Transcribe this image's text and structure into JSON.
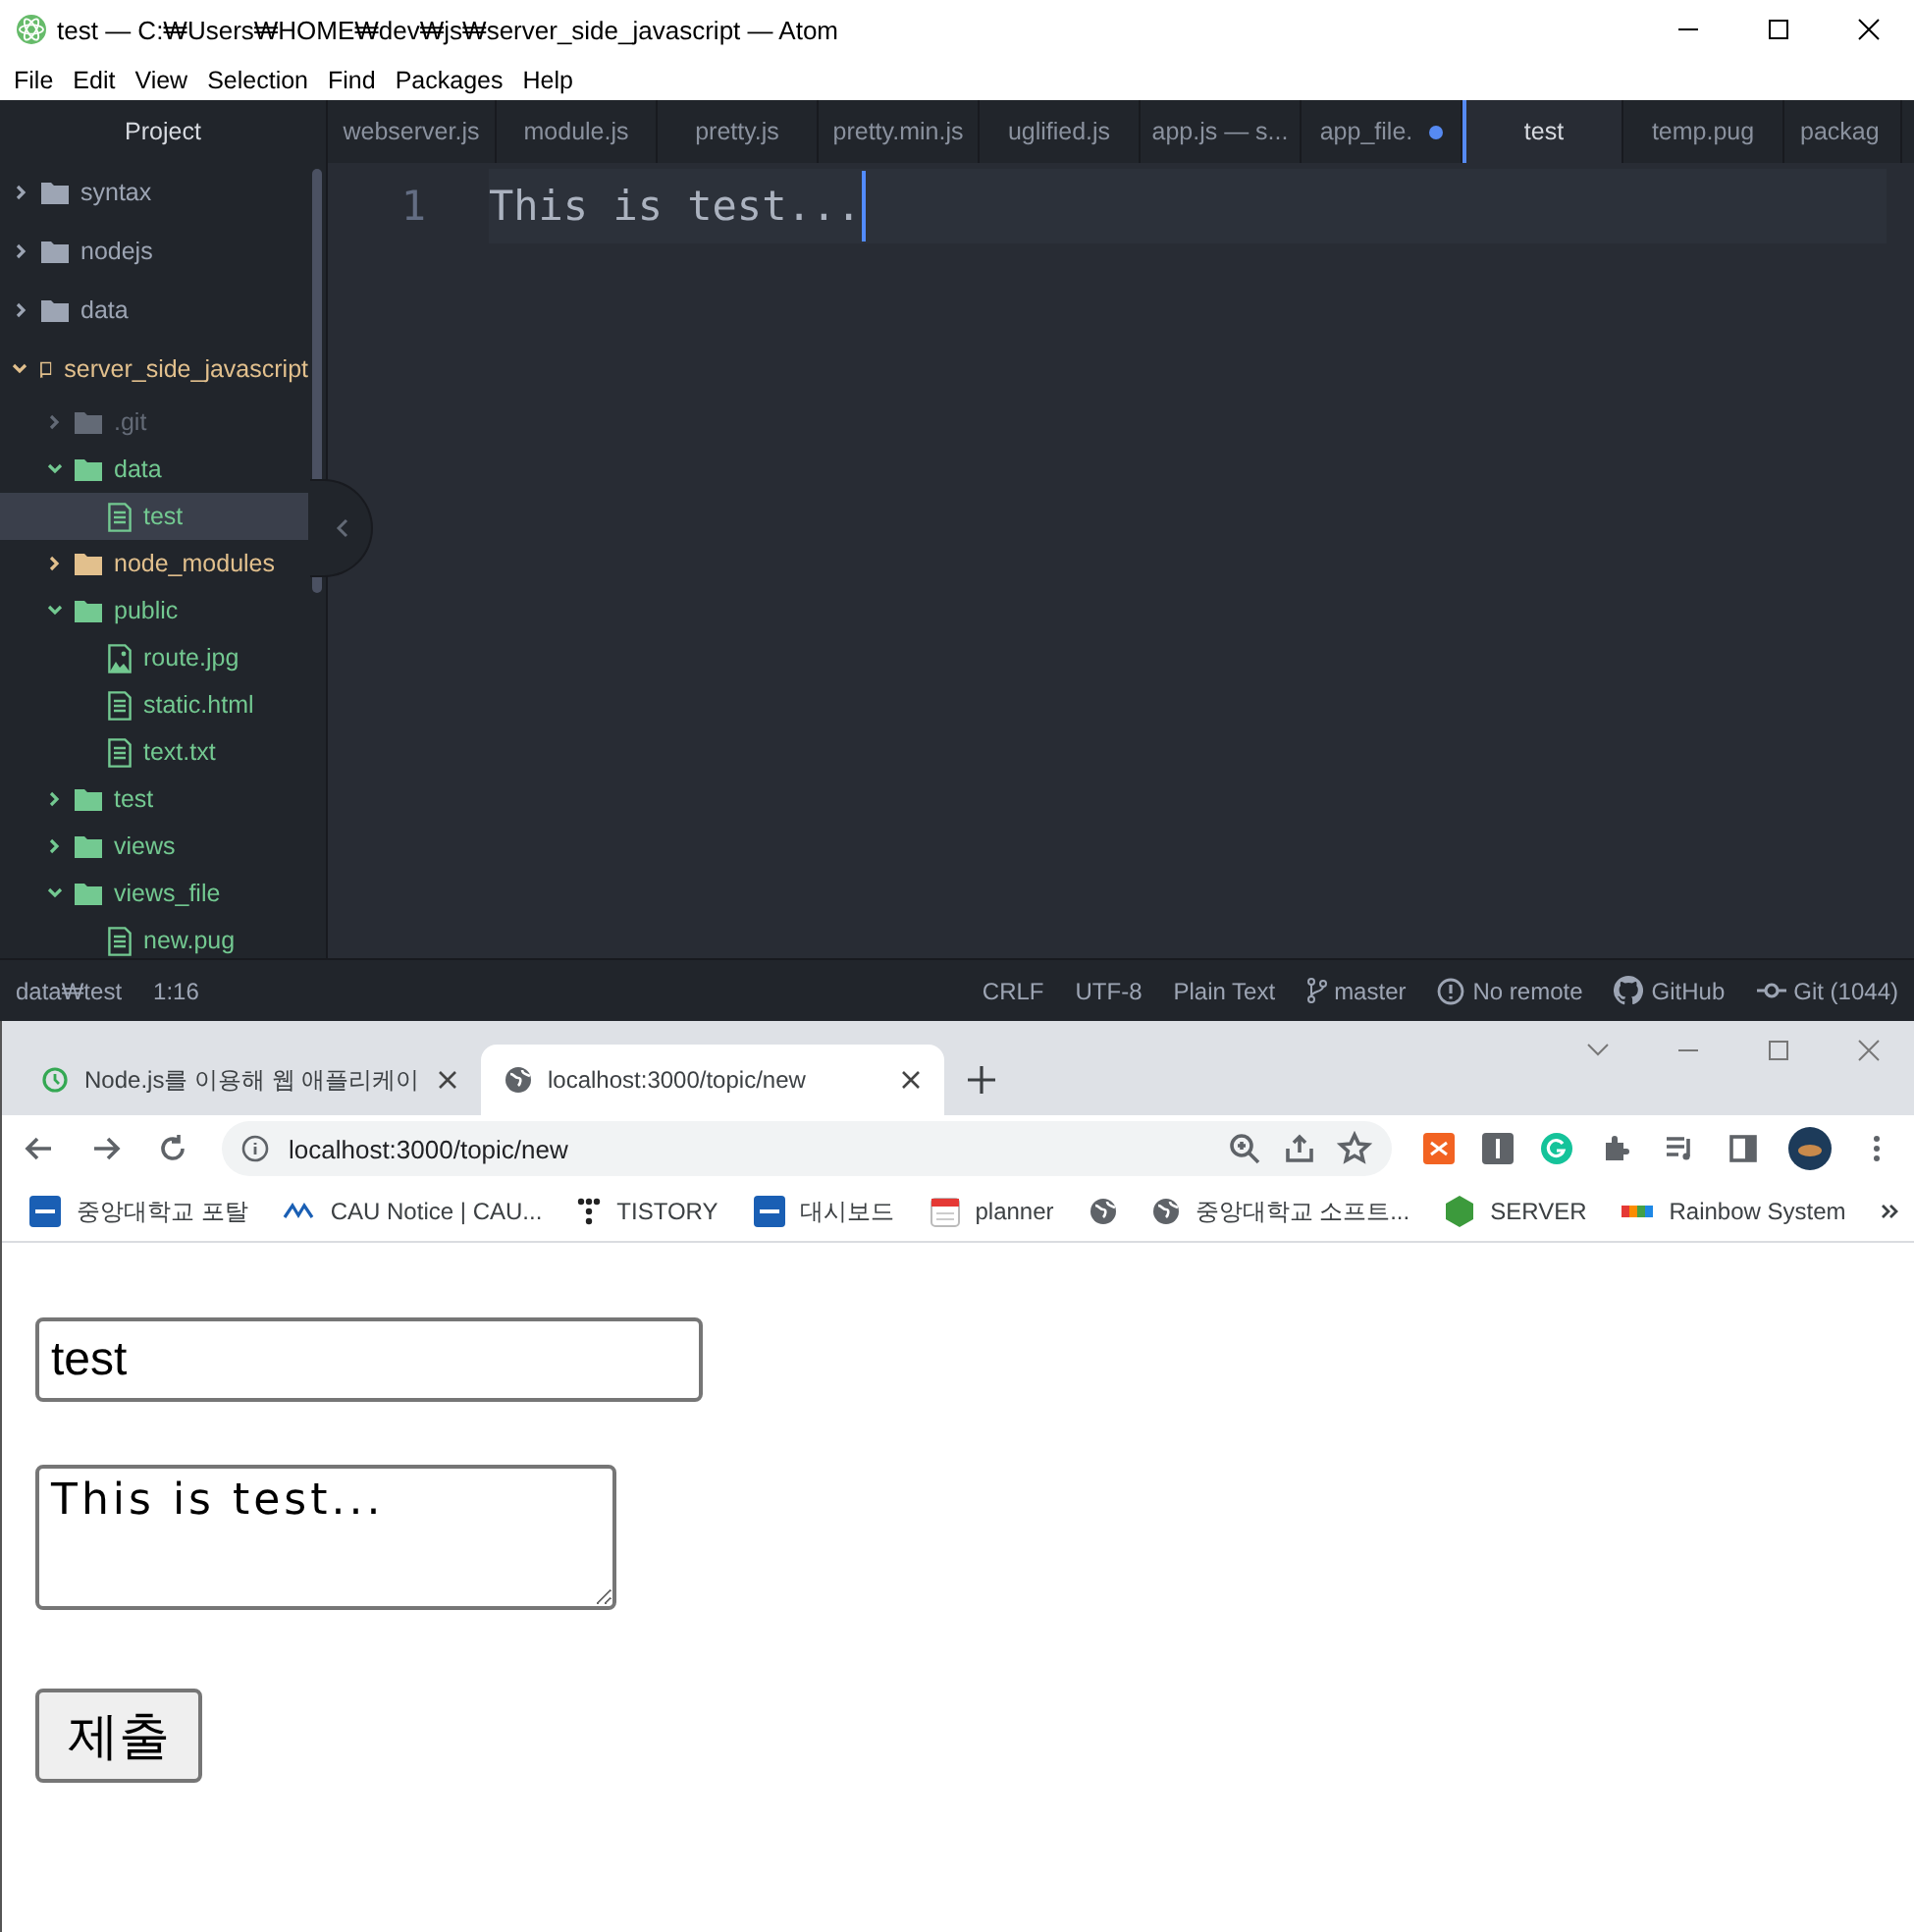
{
  "atom": {
    "title": "test — C:₩Users₩HOME₩dev₩js₩server_side_javascript — Atom",
    "menu": [
      "File",
      "Edit",
      "View",
      "Selection",
      "Find",
      "Packages",
      "Help"
    ],
    "project_label": "Project",
    "tree": [
      {
        "name": "syntax",
        "kind": "folder",
        "expanded": false,
        "color": "#9da5b4",
        "selected": false
      },
      {
        "name": "nodejs",
        "kind": "folder",
        "expanded": false,
        "color": "#9da5b4",
        "selected": false
      },
      {
        "name": "data",
        "kind": "folder",
        "expanded": false,
        "color": "#9da5b4",
        "selected": false
      },
      {
        "name": "server_side_javascript",
        "kind": "repo",
        "expanded": true,
        "color": "#e2c08d",
        "selected": false,
        "children": [
          {
            "name": ".git",
            "kind": "folder",
            "expanded": false,
            "color": "#636a76",
            "selected": false
          },
          {
            "name": "data",
            "kind": "folder",
            "expanded": true,
            "color": "#73c991",
            "selected": false,
            "children": [
              {
                "name": "test",
                "kind": "file",
                "color": "#73c991",
                "selected": true
              }
            ]
          },
          {
            "name": "node_modules",
            "kind": "folder",
            "expanded": false,
            "color": "#e2c08d",
            "selected": false
          },
          {
            "name": "public",
            "kind": "folder",
            "expanded": true,
            "color": "#73c991",
            "selected": false,
            "children": [
              {
                "name": "route.jpg",
                "kind": "image",
                "color": "#73c991",
                "selected": false
              },
              {
                "name": "static.html",
                "kind": "file",
                "color": "#73c991",
                "selected": false
              },
              {
                "name": "text.txt",
                "kind": "file",
                "color": "#73c991",
                "selected": false
              }
            ]
          },
          {
            "name": "test",
            "kind": "folder",
            "expanded": false,
            "color": "#73c991",
            "selected": false
          },
          {
            "name": "views",
            "kind": "folder",
            "expanded": false,
            "color": "#73c991",
            "selected": false
          },
          {
            "name": "views_file",
            "kind": "folder",
            "expanded": true,
            "color": "#73c991",
            "selected": false,
            "children": [
              {
                "name": "new.pug",
                "kind": "file",
                "color": "#73c991",
                "selected": false
              }
            ]
          }
        ]
      }
    ],
    "tabs": [
      {
        "label": "webserver.js",
        "selected": false,
        "modified": false
      },
      {
        "label": "module.js",
        "selected": false,
        "modified": false
      },
      {
        "label": "pretty.js",
        "selected": false,
        "modified": false
      },
      {
        "label": "pretty.min.js",
        "selected": false,
        "modified": false
      },
      {
        "label": "uglified.js",
        "selected": false,
        "modified": false
      },
      {
        "label": "app.js — s...",
        "selected": false,
        "modified": false
      },
      {
        "label": "app_file.",
        "selected": false,
        "modified": true
      },
      {
        "label": "test",
        "selected": true,
        "modified": false
      },
      {
        "label": "temp.pug",
        "selected": false,
        "modified": false
      },
      {
        "label": "packag",
        "selected": false,
        "modified": false
      }
    ],
    "editor": {
      "line_number": "1",
      "text": "This is test..."
    },
    "status_bar": {
      "path": "data₩test",
      "cursor": "1:16",
      "right": [
        {
          "label": "CRLF",
          "kind": "text"
        },
        {
          "label": "UTF-8",
          "kind": "text"
        },
        {
          "label": "Plain Text",
          "kind": "text"
        },
        {
          "label": "master",
          "kind": "branch"
        },
        {
          "label": "No remote",
          "kind": "alert"
        },
        {
          "label": "GitHub",
          "kind": "github"
        },
        {
          "label": "Git (1044)",
          "kind": "commit"
        }
      ]
    }
  },
  "browser": {
    "tabs": [
      {
        "title": "Node.js를 이용해 웹 애플리케이",
        "selected": false
      },
      {
        "title": "localhost:3000/topic/new",
        "selected": true
      }
    ],
    "url": "localhost:3000/topic/new",
    "bookmarks": [
      {
        "label": "중앙대학교 포탈",
        "kind": "cau"
      },
      {
        "label": "CAU Notice | CAU...",
        "kind": "cau-small"
      },
      {
        "label": "TISTORY",
        "kind": "dots"
      },
      {
        "label": "대시보드",
        "kind": "cau"
      },
      {
        "label": "planner",
        "kind": "calendar"
      },
      {
        "kind": "globe"
      },
      {
        "label": "중앙대학교 소프트...",
        "kind": "globe"
      },
      {
        "label": "SERVER",
        "kind": "hex"
      },
      {
        "label": "Rainbow System",
        "kind": "rainbow"
      }
    ],
    "form": {
      "title_value": "test",
      "description_value": "This is test...",
      "submit": "제출"
    }
  }
}
